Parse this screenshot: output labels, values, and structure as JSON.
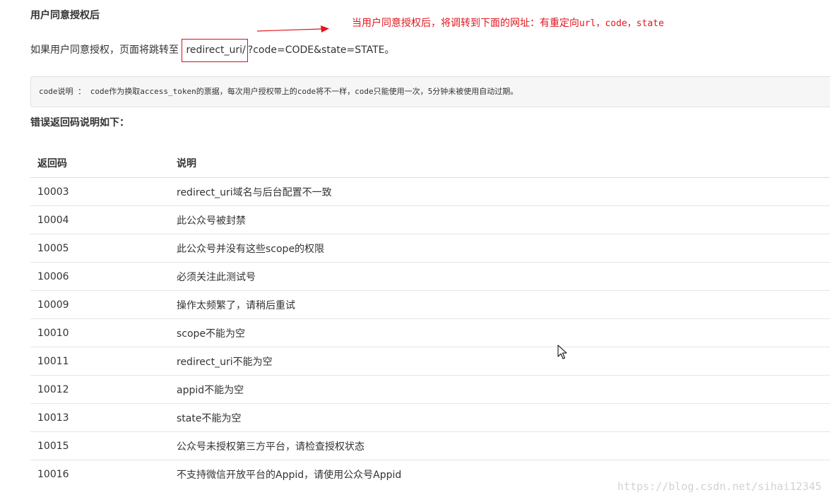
{
  "heading": "用户同意授权后",
  "paragraph": {
    "prefix": "如果用户同意授权，页面将跳转至 ",
    "boxed": "redirect_uri/",
    "suffix": "?code=CODE&state=STATE。"
  },
  "annotation": {
    "text": "当用户同意授权后，将调转到下面的网址：有重定向",
    "mono": "url，code，state",
    "color": "#e0161e"
  },
  "code_note": "code说明 ： code作为换取access_token的票据，每次用户授权带上的code将不一样，code只能使用一次，5分钟未被使用自动过期。",
  "error_heading": "错误返回码说明如下：",
  "table": {
    "headers": [
      "返回码",
      "说明"
    ],
    "rows": [
      {
        "code": "10003",
        "desc": "redirect_uri域名与后台配置不一致"
      },
      {
        "code": "10004",
        "desc": "此公众号被封禁"
      },
      {
        "code": "10005",
        "desc": "此公众号并没有这些scope的权限"
      },
      {
        "code": "10006",
        "desc": "必须关注此测试号"
      },
      {
        "code": "10009",
        "desc": "操作太频繁了，请稍后重试"
      },
      {
        "code": "10010",
        "desc": "scope不能为空"
      },
      {
        "code": "10011",
        "desc": "redirect_uri不能为空"
      },
      {
        "code": "10012",
        "desc": "appid不能为空"
      },
      {
        "code": "10013",
        "desc": "state不能为空"
      },
      {
        "code": "10015",
        "desc": "公众号未授权第三方平台，请检查授权状态"
      },
      {
        "code": "10016",
        "desc": "不支持微信开放平台的Appid，请使用公众号Appid"
      }
    ]
  },
  "watermark": "https://blog.csdn.net/sihai12345",
  "icons": {
    "arrow": "red-arrow-icon",
    "cursor": "mouse-pointer-icon"
  }
}
